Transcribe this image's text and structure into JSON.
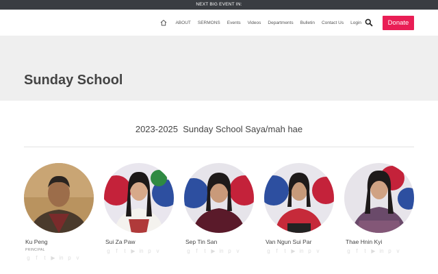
{
  "topbar": {
    "text": "NEXT BIG EVENT IN:"
  },
  "nav": {
    "home_icon": "home-icon",
    "items": [
      "ABOUT",
      "SERMONS",
      "Events",
      "Videos",
      "Departments",
      "Bulletin",
      "Contact Us",
      "Login"
    ],
    "search_icon": "search-icon",
    "donate_label": "Donate",
    "donate_color": "#e91e55"
  },
  "hero": {
    "title": "Sunday School"
  },
  "section": {
    "heading": "2023-2025  Sunday School Saya/mah hae"
  },
  "members": [
    {
      "name": "Ku Peng",
      "role": "PRINCIPAL"
    },
    {
      "name": "Sui Za Paw",
      "role": ""
    },
    {
      "name": "Sep Tin San",
      "role": ""
    },
    {
      "name": "Van Ngun Sui Par",
      "role": ""
    },
    {
      "name": "Thae Hnin Kyi",
      "role": ""
    }
  ],
  "social_icons": [
    "google-plus-icon",
    "facebook-icon",
    "twitter-icon",
    "youtube-icon",
    "linkedin-icon",
    "pinterest-icon",
    "vimeo-icon"
  ]
}
